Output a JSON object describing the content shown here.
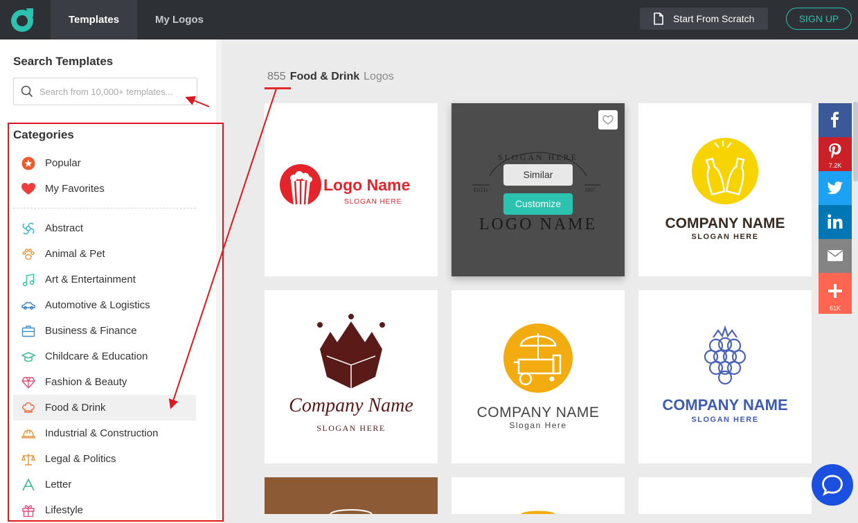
{
  "nav": {
    "tabs": [
      {
        "label": "Templates",
        "active": true
      },
      {
        "label": "My Logos",
        "active": false
      }
    ],
    "start_scratch_label": "Start From Scratch",
    "signup_label": "SIGN UP"
  },
  "sidebar": {
    "search_title": "Search Templates",
    "search_placeholder": "Search from 10,000+ templates...",
    "categories_title": "Categories",
    "top_items": [
      {
        "label": "Popular",
        "icon": "star-badge-icon"
      },
      {
        "label": "My Favorites",
        "icon": "heart-icon"
      }
    ],
    "items": [
      {
        "label": "Abstract",
        "icon": "abstract-icon"
      },
      {
        "label": "Animal & Pet",
        "icon": "paw-icon"
      },
      {
        "label": "Art & Entertainment",
        "icon": "music-note-icon"
      },
      {
        "label": "Automotive & Logistics",
        "icon": "car-icon"
      },
      {
        "label": "Business & Finance",
        "icon": "briefcase-icon"
      },
      {
        "label": "Childcare & Education",
        "icon": "graduation-cap-icon"
      },
      {
        "label": "Fashion & Beauty",
        "icon": "diamond-icon"
      },
      {
        "label": "Food & Drink",
        "icon": "chef-hat-icon",
        "selected": true
      },
      {
        "label": "Industrial & Construction",
        "icon": "hard-hat-icon"
      },
      {
        "label": "Legal & Politics",
        "icon": "scales-icon"
      },
      {
        "label": "Letter",
        "icon": "letter-a-icon"
      },
      {
        "label": "Lifestyle",
        "icon": "gift-icon"
      }
    ]
  },
  "main": {
    "count": "855",
    "category": "Food & Drink",
    "suffix": "Logos",
    "hover_actions": {
      "similar": "Similar",
      "customize": "Customize"
    },
    "cards": [
      {
        "name": "Logo Name",
        "slogan": "SLOGAN HERE"
      },
      {
        "name": "LOGO NAME",
        "slogan": "SLOGAN HERE",
        "estd": "ESTD",
        "year": "1997."
      },
      {
        "name": "COMPANY NAME",
        "slogan": "SLOGAN HERE"
      },
      {
        "name": "Company Name",
        "slogan": "SLOGAN HERE"
      },
      {
        "name": "COMPANY NAME",
        "slogan": "Slogan Here"
      },
      {
        "name": "COMPANY NAME",
        "slogan": "SLOGAN HERE"
      }
    ]
  },
  "social": [
    {
      "name": "facebook",
      "color": "#3b5998",
      "count": ""
    },
    {
      "name": "pinterest",
      "color": "#cb2027",
      "count": "7.2K"
    },
    {
      "name": "twitter",
      "color": "#1da1f2",
      "count": ""
    },
    {
      "name": "linkedin",
      "color": "#0077b5",
      "count": ""
    },
    {
      "name": "email",
      "color": "#848484",
      "count": ""
    },
    {
      "name": "share-more",
      "color": "#ff6550",
      "count": "61K"
    }
  ]
}
